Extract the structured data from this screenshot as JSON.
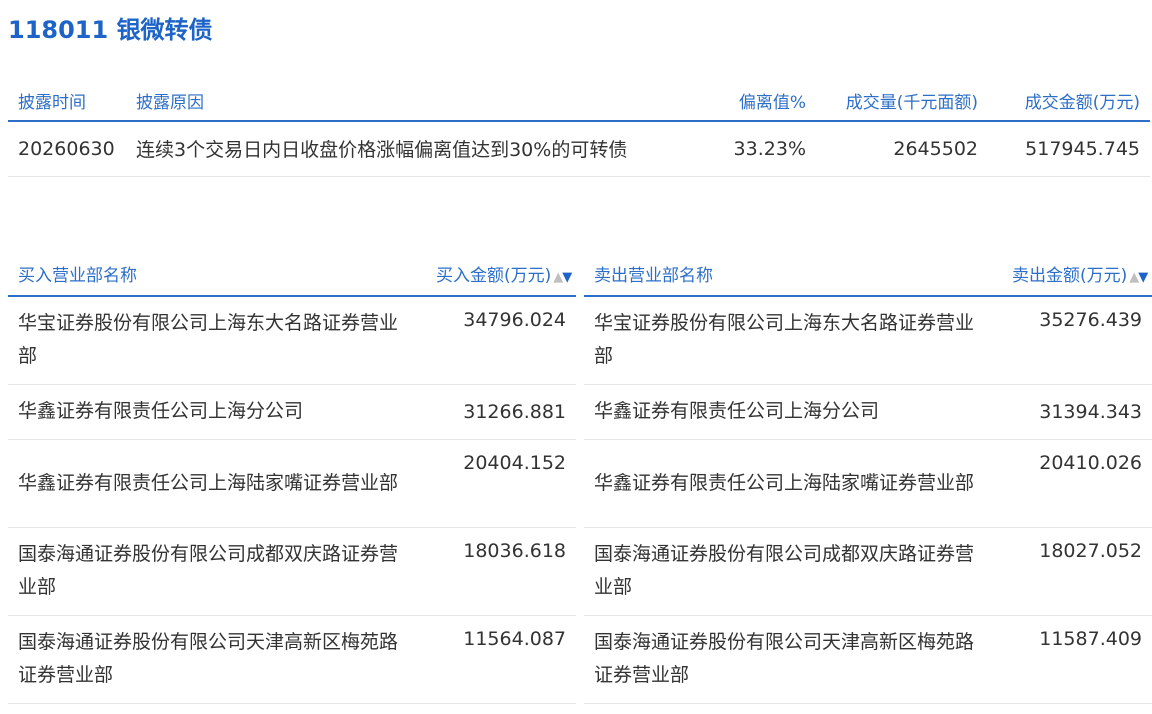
{
  "bond": {
    "code": "118011",
    "name": "银微转债"
  },
  "disclosure": {
    "headers": {
      "date": "披露时间",
      "reason": "披露原因",
      "deviation": "偏离值%",
      "volume": "成交量(千元面额)",
      "amount": "成交金额(万元)"
    },
    "rows": [
      {
        "date": "20260630",
        "reason": "连续3个交易日内日收盘价格涨幅偏离值达到30%的可转债",
        "deviation": "33.23%",
        "volume": "2645502",
        "amount": "517945.745"
      }
    ]
  },
  "buy": {
    "headers": {
      "name": "买入营业部名称",
      "amount": "买入金额(万元)"
    },
    "sort": {
      "up": "▲",
      "down": "▼"
    },
    "rows": [
      {
        "name": "华宝证券股份有限公司上海东大名路证券营业部",
        "amount": "34796.024"
      },
      {
        "name": "华鑫证券有限责任公司上海分公司",
        "amount": "31266.881"
      },
      {
        "name": "华鑫证券有限责任公司上海陆家嘴证券营业部",
        "amount": "20404.152"
      },
      {
        "name": "国泰海通证券股份有限公司成都双庆路证券营业部",
        "amount": "18036.618"
      },
      {
        "name": "国泰海通证券股份有限公司天津高新区梅苑路证券营业部",
        "amount": "11564.087"
      }
    ]
  },
  "sell": {
    "headers": {
      "name": "卖出营业部名称",
      "amount": "卖出金额(万元)"
    },
    "sort": {
      "up": "▲",
      "down": "▼"
    },
    "rows": [
      {
        "name": "华宝证券股份有限公司上海东大名路证券营业部",
        "amount": "35276.439"
      },
      {
        "name": "华鑫证券有限责任公司上海分公司",
        "amount": "31394.343"
      },
      {
        "name": "华鑫证券有限责任公司上海陆家嘴证券营业部",
        "amount": "20410.026"
      },
      {
        "name": "国泰海通证券股份有限公司成都双庆路证券营业部",
        "amount": "18027.052"
      },
      {
        "name": "国泰海通证券股份有限公司天津高新区梅苑路证券营业部",
        "amount": "11587.409"
      }
    ]
  },
  "colors": {
    "accent": "#1e64c8",
    "header_text": "#2d6fc8",
    "divider": "#e6e6e6",
    "sort_inactive": "#bfbfbf"
  }
}
